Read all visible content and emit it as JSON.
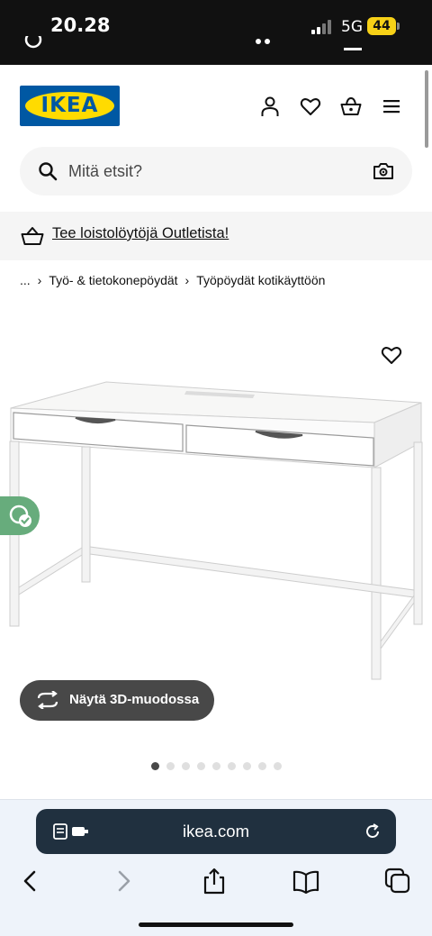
{
  "status_bar": {
    "time": "20.28",
    "network": "5G",
    "battery": "44"
  },
  "header": {
    "logo_text": "IKEA"
  },
  "search": {
    "placeholder": "Mitä etsit?"
  },
  "promo": {
    "text": "Tee loistolöytöjä Outletista!"
  },
  "breadcrumb": {
    "items": [
      "...",
      "Työ- & tietokonepöydät",
      "Työpöydät kotikäyttöön"
    ]
  },
  "product_view": {
    "three_d_label": "Näytä 3D-muodossa",
    "image_count": 9,
    "active_image": 1
  },
  "browser": {
    "url": "ikea.com"
  },
  "colors": {
    "ikea_blue": "#0058a3",
    "ikea_yellow": "#ffdb00",
    "dark_button": "#484848",
    "url_bar": "#20303f",
    "floating_badge": "#67ac7c"
  }
}
